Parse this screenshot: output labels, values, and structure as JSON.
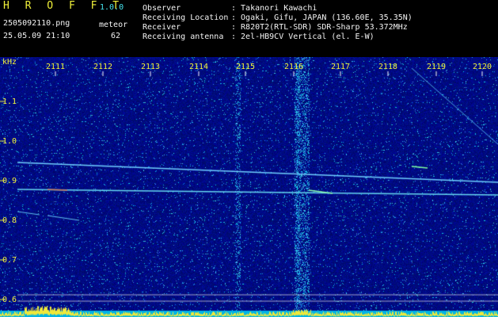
{
  "header": {
    "app_name": "H R O F F T",
    "version": "1.0.0",
    "filename": "2505092110.png",
    "datetime": "25.05.09 21:10",
    "counter_label": "meteor",
    "counter_value": "62"
  },
  "info": {
    "rows": [
      {
        "label": "Observer",
        "value": ": Takanori Kawachi"
      },
      {
        "label": "Receiving Location",
        "value": ": Ogaki, Gifu, JAPAN (136.60E, 35.35N)"
      },
      {
        "label": "Receiver",
        "value": ": R820T2(RTL-SDR) SDR-Sharp 53.372MHz"
      },
      {
        "label": "Receiving antenna",
        "value": ": 2el-HB9CV Vertical (el. E-W)"
      }
    ]
  },
  "spectrogram": {
    "y_unit": "kHz",
    "x_ticks": [
      "2111",
      "2112",
      "2113",
      "2114",
      "2115",
      "2116",
      "2117",
      "2118",
      "2119",
      "2120"
    ],
    "y_ticks": [
      "1.1",
      "1.0",
      "0.9",
      "0.8",
      "0.7",
      "0.6"
    ]
  },
  "colors": {
    "label": "#f2f23a",
    "text": "#f4f4f4",
    "accent": "#46e6f0",
    "background": "#05107e",
    "trace": "#5ec8f0"
  }
}
